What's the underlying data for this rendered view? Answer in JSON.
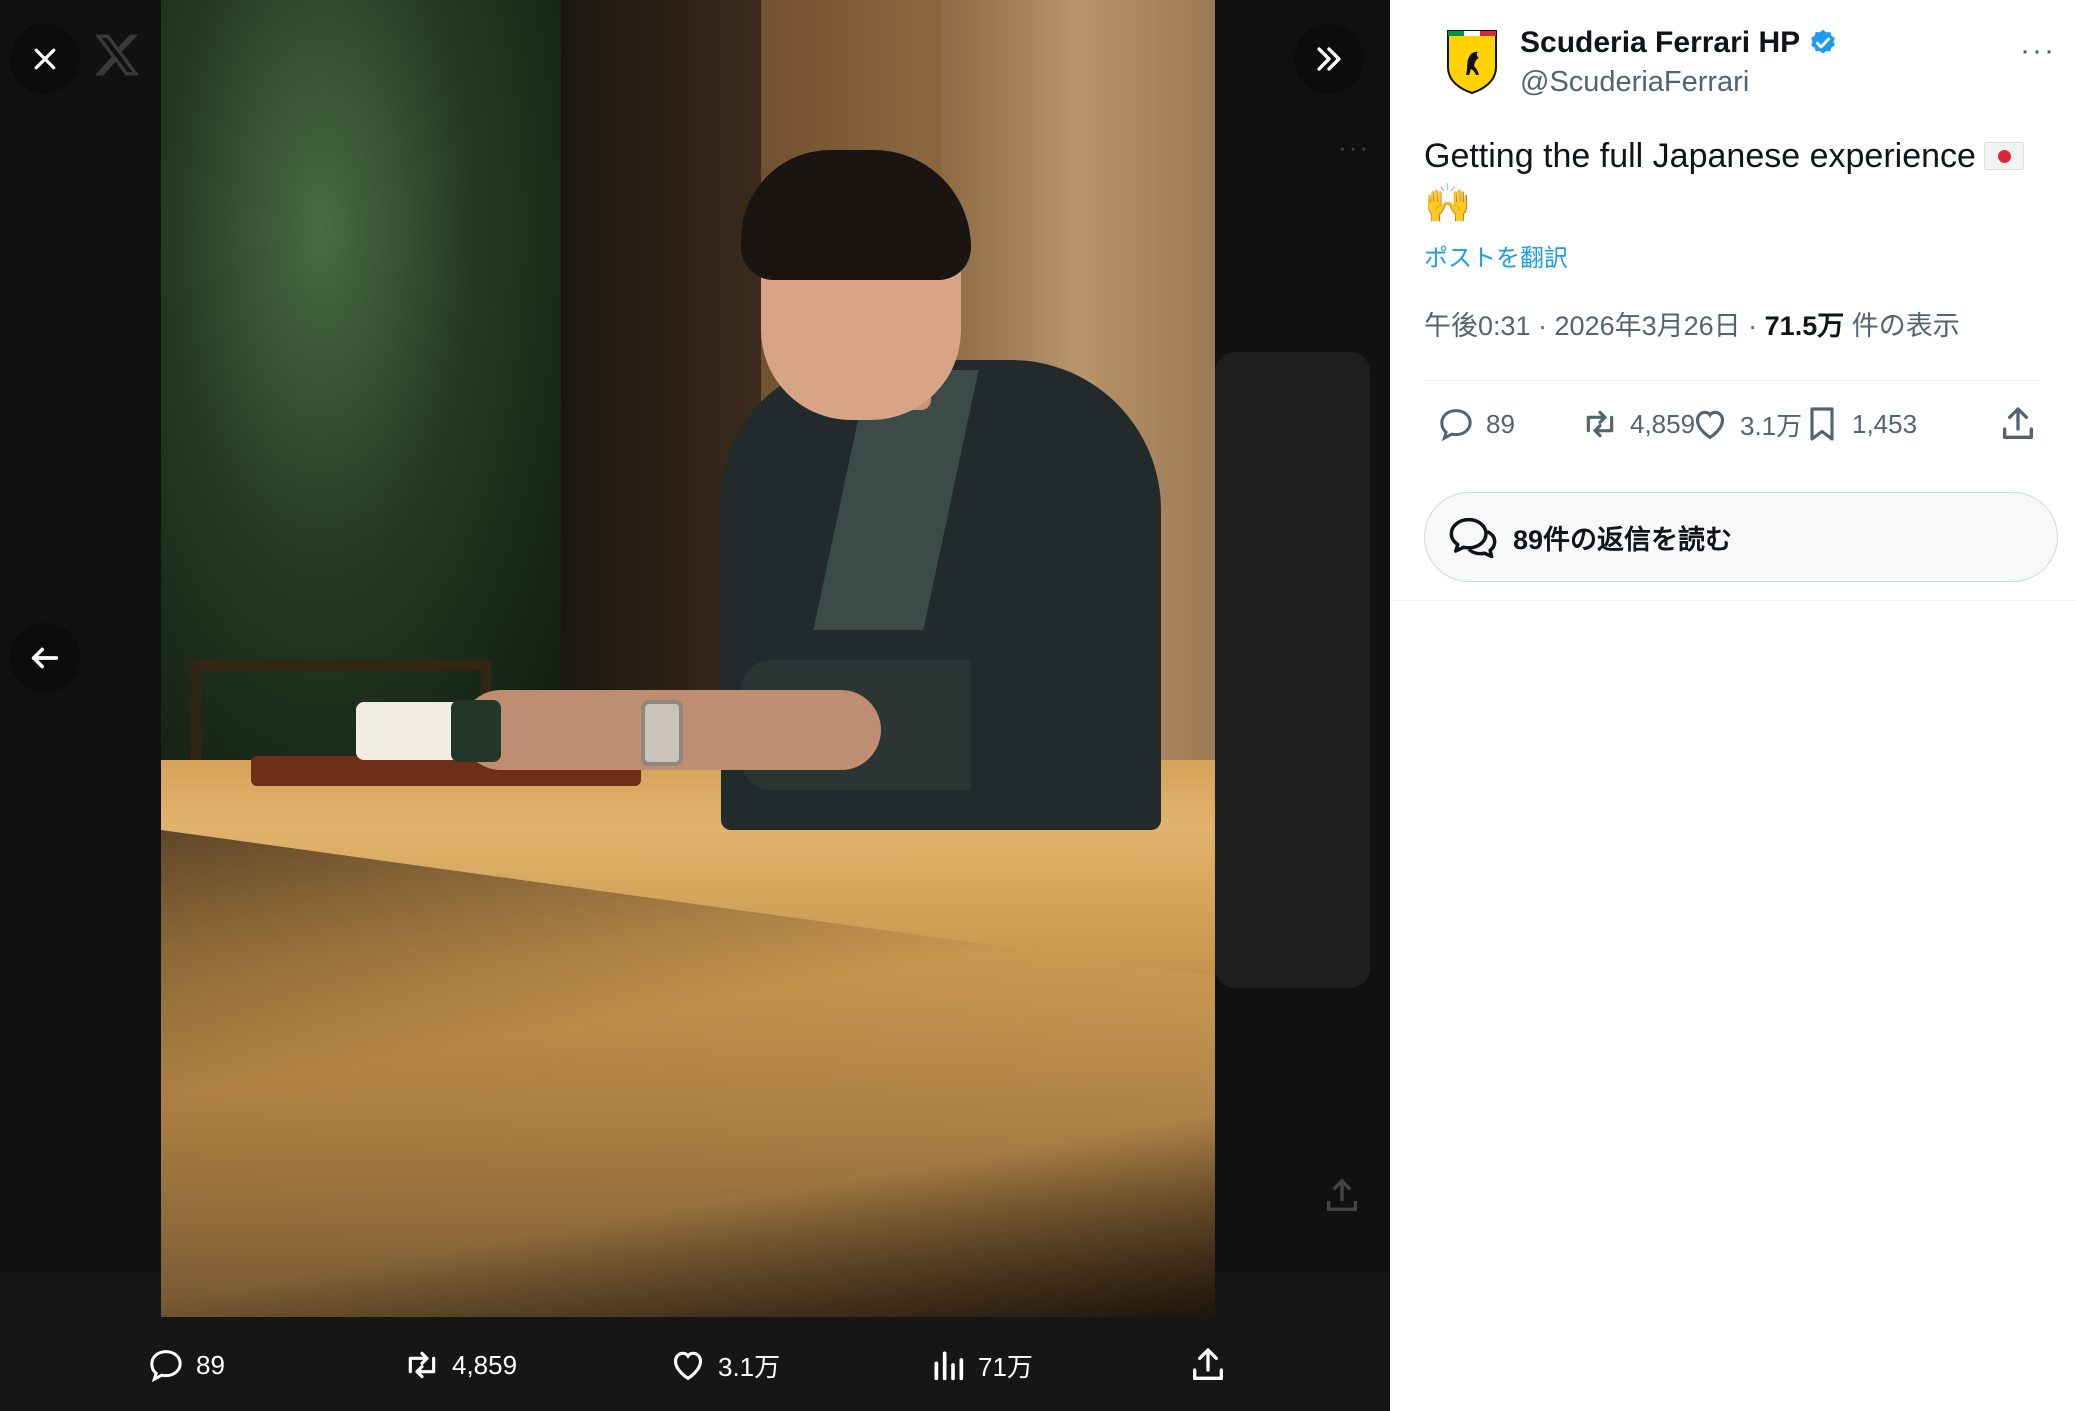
{
  "viewer": {
    "close_icon": "close-icon",
    "x_logo": "x-logo-icon",
    "expand_icon": "double-chevron-right-icon",
    "back_icon": "arrow-left-icon",
    "photo_alt": "Man in dark kimono seated at wooden counter",
    "actions": {
      "replies": "89",
      "reposts": "4,859",
      "likes": "3.1万",
      "views": "71万"
    }
  },
  "post": {
    "author_name": "Scuderia Ferrari HP",
    "verified": true,
    "author_handle": "@ScuderiaFerrari",
    "more_icon": "more-dots-icon",
    "text": "Getting the full Japanese experience",
    "emoji_hands": "🙌",
    "translate_label": "ポストを翻訳",
    "time": "午後0:31 · 2026年3月26日 · ",
    "views_count": "71.5万",
    "views_label": " 件の表示",
    "actions": {
      "replies": "89",
      "reposts": "4,859",
      "likes": "3.1万",
      "bookmarks": "1,453"
    },
    "read_replies_label": "89件の返信を読む"
  },
  "colors": {
    "accent": "#1d9bf0",
    "text_primary": "#0f1419",
    "text_secondary": "#536471",
    "verified": "#1d9bf0"
  }
}
